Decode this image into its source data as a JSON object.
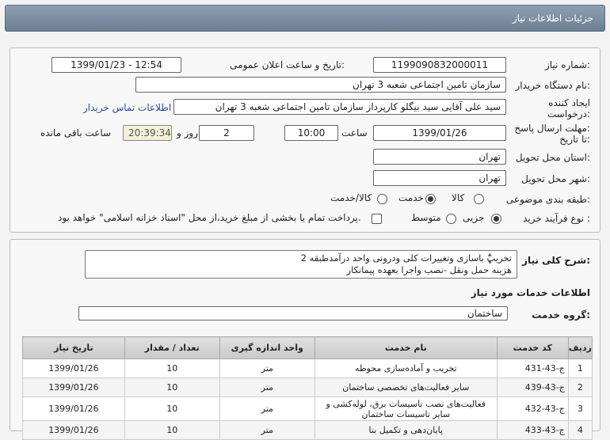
{
  "header": {
    "title": "جزئیات اطلاعات نیاز"
  },
  "form": {
    "need_number_label": "شماره نیاز:",
    "need_number": "1199090832000011",
    "announce_label": "تاریخ و ساعت اعلان عمومی:",
    "announce_value": "1399/01/23 - 12:54",
    "buyer_label": "نام دستگاه خریدار:",
    "buyer_value": "سازمان تامین اجتماعی شعبه 3 تهران",
    "creator_label_1": "ایجاد کننده",
    "creator_label_2": "درخواست:",
    "creator_value": "سید علی آقایی سید بیگلو کارپرداز سازمان تامین اجتماعی شعبه 3 تهران",
    "contact_link": "اطلاعات تماس خریدار",
    "deadline_label_1": "مهلت ارسال پاسخ:",
    "deadline_label_2": "تا تاریخ:",
    "deadline_date": "1399/01/26",
    "time_label": "ساعت",
    "deadline_time": "10:00",
    "days_value": "2",
    "days_label": "روز و",
    "remaining_time": "20:39:34",
    "remaining_label": "ساعت باقی مانده",
    "province_label": "استان محل تحویل:",
    "province_value": "تهران",
    "city_label": "شهر محل تحویل:",
    "city_value": "تهران",
    "category_label": "طبقه بندی موضوعی:",
    "category_options": [
      "کالا",
      "خدمت",
      "کالا/خدمت"
    ],
    "category_selected": "خدمت",
    "process_label": "نوع فرآیند خرید :",
    "process_options": [
      "جزیی",
      "متوسط"
    ],
    "process_selected": "جزیی",
    "payment_note": "پرداخت تمام یا بخشی از مبلغ خرید،از محل \"اسناد خزانه اسلامی\" خواهد بود."
  },
  "description": {
    "label": "شرح کلی نیاز:",
    "line1": "تخریب باسازی وتغییرات کلی ودرونی واحد درآمدطبقه 2",
    "line2": "هزینه حمل ونقل -نصب واجرا بعهده پیمانکار"
  },
  "services": {
    "section_title": "اطلاعات خدمات مورد نیاز",
    "group_label": "گروه خدمت:",
    "group_value": "ساختمان"
  },
  "table": {
    "headers": [
      "ردیف",
      "کد خدمت",
      "نام خدمت",
      "واحد اندازه گیری",
      "تعداد / مقدار",
      "تاریخ نیاز"
    ],
    "rows": [
      [
        "1",
        "ج-43-431",
        "تخریب و آماده‌سازی محوطه",
        "متر",
        "10",
        "1399/01/26"
      ],
      [
        "2",
        "ج-43-439",
        "سایر فعالیت‌های تخصصی ساختمان",
        "متر",
        "10",
        "1399/01/26"
      ],
      [
        "3",
        "ج-43-432",
        "فعالیت‌های نصب تاسیسات برق، لوله‌کشی و سایر تاسیسات ساختمان",
        "متر",
        "10",
        "1399/01/26"
      ],
      [
        "4",
        "ج-43-433",
        "پایان‌دهی و تکمیل بنا",
        "متر",
        "10",
        "1399/01/26"
      ]
    ]
  }
}
